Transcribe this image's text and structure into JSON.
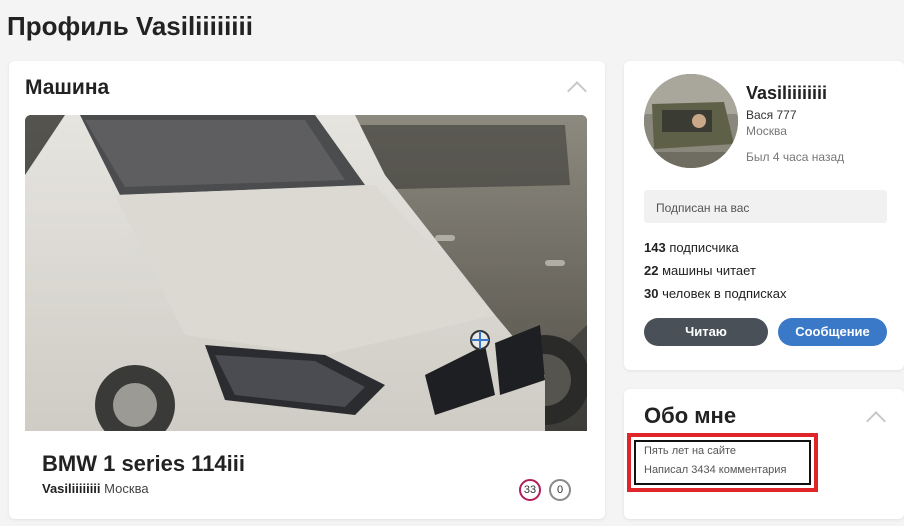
{
  "page": {
    "title": "Профиль Vasiliiiiiiii"
  },
  "car_card": {
    "title": "Машина",
    "car_name": "BMW 1 series 114iii",
    "owner": "Vasiliiiiiiii",
    "city": "Москва",
    "likes_count": "33",
    "comments_count": "0"
  },
  "profile": {
    "nick": "Vasiliiiiiiii",
    "real_name": "Вася 777",
    "city": "Москва",
    "last_seen": "Был 4 часа назад",
    "follows_you": "Подписан на вас",
    "stats": [
      {
        "value": "143",
        "label": "подписчика"
      },
      {
        "value": "22",
        "label": "машины читает"
      },
      {
        "value": "30",
        "label": "человек в подписках"
      }
    ],
    "read_button": "Читаю",
    "message_button": "Сообщение"
  },
  "about": {
    "title": "Обо мне",
    "lines": [
      "Пять лет на сайте",
      "Написал 3434 комментария"
    ]
  },
  "colors": {
    "accent_blue": "#3a78c8",
    "button_dark": "#4a5058",
    "highlight_red": "#e0252a",
    "likes_ring": "#b01f5a"
  },
  "icons": {
    "collapse": "chevron-up-icon"
  }
}
